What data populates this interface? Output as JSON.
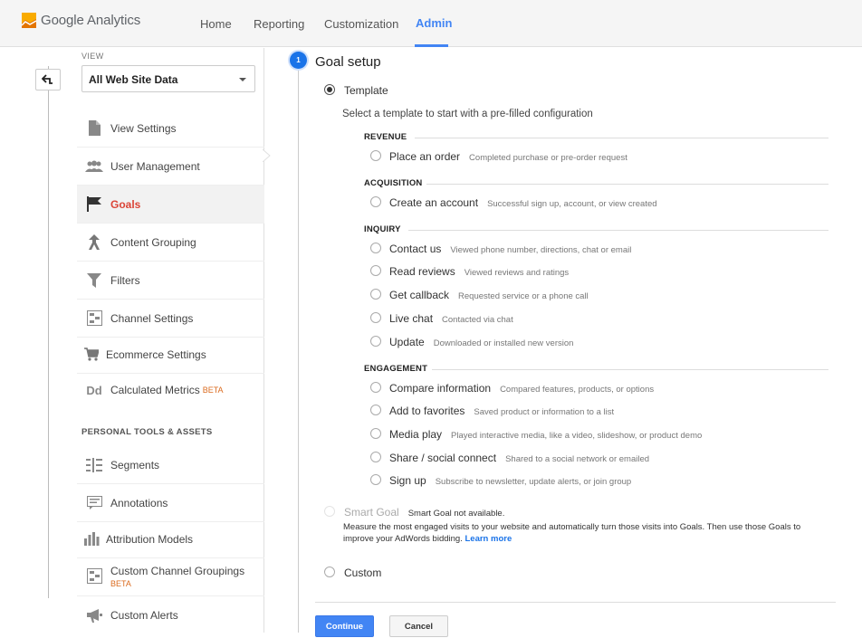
{
  "app": {
    "logo_text": "Google Analytics",
    "brand_colors": {
      "logo_orange": "#f9ab00",
      "logo_dark_orange": "#e37400",
      "accent_blue": "#4285f4",
      "active_red": "#db4437"
    }
  },
  "nav": {
    "items": [
      {
        "label": "Home"
      },
      {
        "label": "Reporting"
      },
      {
        "label": "Customization"
      },
      {
        "label": "Admin",
        "active": true
      }
    ]
  },
  "sidebar": {
    "back_icon": "back-arrow-icon",
    "view_label": "VIEW",
    "view_selected": "All Web Site Data",
    "items": [
      {
        "label": "View Settings",
        "icon": "document-icon"
      },
      {
        "label": "User Management",
        "icon": "users-icon"
      },
      {
        "label": "Goals",
        "icon": "flag-icon",
        "active": true
      },
      {
        "label": "Content Grouping",
        "icon": "content-grouping-icon"
      },
      {
        "label": "Filters",
        "icon": "filter-icon"
      },
      {
        "label": "Channel Settings",
        "icon": "channel-settings-icon"
      },
      {
        "label": "Ecommerce Settings",
        "icon": "cart-icon"
      },
      {
        "label": "Calculated Metrics",
        "icon": "dd-icon",
        "badge": "BETA"
      }
    ],
    "section_heading": "PERSONAL TOOLS & ASSETS",
    "tools": [
      {
        "label": "Segments",
        "icon": "segments-icon"
      },
      {
        "label": "Annotations",
        "icon": "annotations-icon"
      },
      {
        "label": "Attribution Models",
        "icon": "bar-chart-icon"
      },
      {
        "label": "Custom Channel Groupings",
        "icon": "channel-groupings-icon",
        "badge": "BETA"
      },
      {
        "label": "Custom Alerts",
        "icon": "megaphone-icon"
      }
    ]
  },
  "goal_setup": {
    "step_number": "1",
    "title": "Goal setup",
    "template_label": "Template",
    "template_selected": true,
    "intro": "Select a template to start with a pre-filled configuration",
    "categories": [
      {
        "name": "REVENUE",
        "options": [
          {
            "label": "Place an order",
            "desc": "Completed purchase or pre-order request"
          }
        ]
      },
      {
        "name": "ACQUISITION",
        "options": [
          {
            "label": "Create an account",
            "desc": "Successful sign up, account, or view created"
          }
        ]
      },
      {
        "name": "INQUIRY",
        "options": [
          {
            "label": "Contact us",
            "desc": "Viewed phone number, directions, chat or email"
          },
          {
            "label": "Read reviews",
            "desc": "Viewed reviews and ratings"
          },
          {
            "label": "Get callback",
            "desc": "Requested service or a phone call"
          },
          {
            "label": "Live chat",
            "desc": "Contacted via chat"
          },
          {
            "label": "Update",
            "desc": "Downloaded or installed new version"
          }
        ]
      },
      {
        "name": "ENGAGEMENT",
        "options": [
          {
            "label": "Compare information",
            "desc": "Compared features, products, or options"
          },
          {
            "label": "Add to favorites",
            "desc": "Saved product or information to a list"
          },
          {
            "label": "Media play",
            "desc": "Played interactive media, like a video, slideshow, or product demo"
          },
          {
            "label": "Share / social connect",
            "desc": "Shared to a social network or emailed"
          },
          {
            "label": "Sign up",
            "desc": "Subscribe to newsletter, update alerts, or join group"
          }
        ]
      }
    ],
    "smart_goal_label": "Smart Goal",
    "smart_goal_status": "Smart Goal not available.",
    "smart_goal_desc": "Measure the most engaged visits to your website and automatically turn those visits into Goals. Then use those Goals to improve your AdWords bidding.",
    "learn_more": "Learn more",
    "custom_label": "Custom",
    "continue_label": "Continue",
    "cancel_label": "Cancel"
  }
}
